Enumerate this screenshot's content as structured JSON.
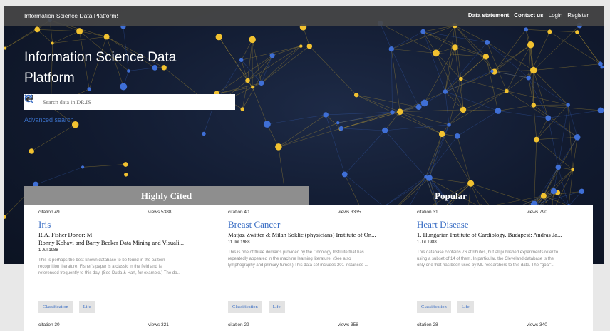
{
  "topbar": {
    "brand": "Information Science Data Platform!",
    "nav": [
      "Data statement",
      "Contact us",
      "Login",
      "Register"
    ]
  },
  "hero": {
    "title_line1": "Information Science Data",
    "title_line2": "Platform",
    "search_placeholder": "Search data in DR.IS",
    "advanced_search": "Advanced search"
  },
  "tabs": {
    "highly_cited": "Highly Cited",
    "popular": "Popular"
  },
  "cards": [
    {
      "citation": "citation 49",
      "views": "views 5388",
      "title": "Iris",
      "author1": "R.A. Fisher Donor: M",
      "author2": "Ronny Kohavi and Barry Becker Data Mining and Visuali...",
      "date": "1 Jul 1988",
      "desc1": "This is perhaps the best known database to be found in the pattern",
      "desc2": "recognition literature. Fisher's paper is a classic in the field and is",
      "desc3": "referenced frequently to this day. (See Duda & Hart, for example.) The da...",
      "tag1": "Classification",
      "tag2": "Life"
    },
    {
      "citation": "citation 40",
      "views": "views 3335",
      "title": "Breast Cancer",
      "author1": "Matjaz Zwitter & Milan Soklic (physicians) Institute of On...",
      "author2": "",
      "date": "11 Jul 1988",
      "desc1": "This is one of three domains provided by the Oncology Institute that has",
      "desc2": "repeatedly appeared in the machine learning literature. (See also",
      "desc3": "lymphography and primary-tumor.) This data set includes 201 instances ...",
      "tag1": "Classification",
      "tag2": "Life"
    },
    {
      "citation": "citation 31",
      "views": "views 790",
      "title": "Heart Disease",
      "author1": "1. Hungarian Institute of Cardiology. Budapest: Andras Ja...",
      "author2": "",
      "date": "1 Jul 1988",
      "desc1": "This database contains 76 attributes, but all published experiments refer to",
      "desc2": "using a subset of 14 of them. In particular, the Cleveland database is the",
      "desc3": "only one that has been used by ML researchers to this date. The \"goal\"...",
      "tag1": "Classification",
      "tag2": "Life"
    }
  ],
  "row2": [
    {
      "citation": "citation 30",
      "views": "views 321"
    },
    {
      "citation": "citation 29",
      "views": "views 358"
    },
    {
      "citation": "citation 28",
      "views": "views 340"
    }
  ],
  "colors": {
    "accent": "#3a6ec4",
    "node_yellow": "#f2c230",
    "node_blue": "#3f6fd6"
  }
}
